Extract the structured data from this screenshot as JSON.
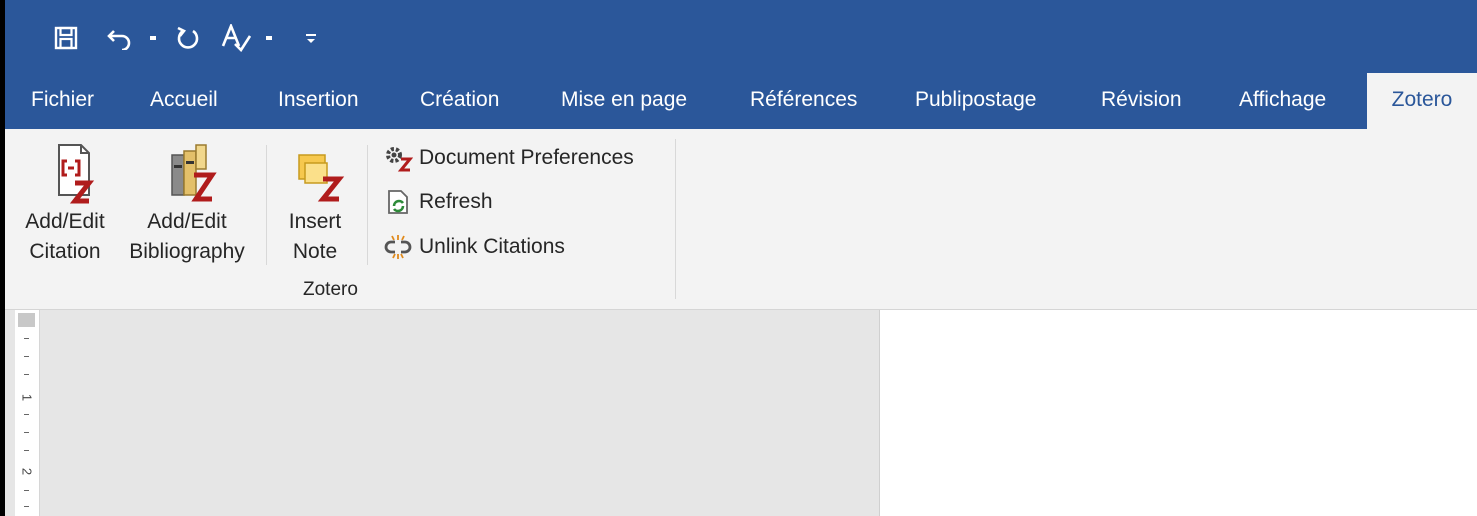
{
  "quick_access": {
    "save_icon": "save-icon",
    "undo_icon": "undo-icon",
    "redo_icon": "repeat-icon",
    "spelling_icon": "spelling-icon",
    "customize_icon": "customize-qat-icon"
  },
  "tabs": [
    {
      "label": "Fichier"
    },
    {
      "label": "Accueil"
    },
    {
      "label": "Insertion"
    },
    {
      "label": "Création"
    },
    {
      "label": "Mise en page"
    },
    {
      "label": "Références"
    },
    {
      "label": "Publipostage"
    },
    {
      "label": "Révision"
    },
    {
      "label": "Affichage"
    },
    {
      "label": "Zotero",
      "active": true
    }
  ],
  "ribbon": {
    "add_edit_citation": {
      "line1": "Add/Edit",
      "line2": "Citation"
    },
    "add_edit_bibliography": {
      "line1": "Add/Edit",
      "line2": "Bibliography"
    },
    "insert_note": {
      "line1": "Insert",
      "line2": "Note"
    },
    "document_preferences": "Document Preferences",
    "refresh": "Refresh",
    "unlink_citations": "Unlink Citations",
    "group_label": "Zotero"
  },
  "ruler": {
    "numbers": [
      "1",
      "2"
    ]
  },
  "colors": {
    "title_bar": "#2b579a",
    "ribbon": "#f3f3f3",
    "zotero_red": "#b01c1c"
  }
}
